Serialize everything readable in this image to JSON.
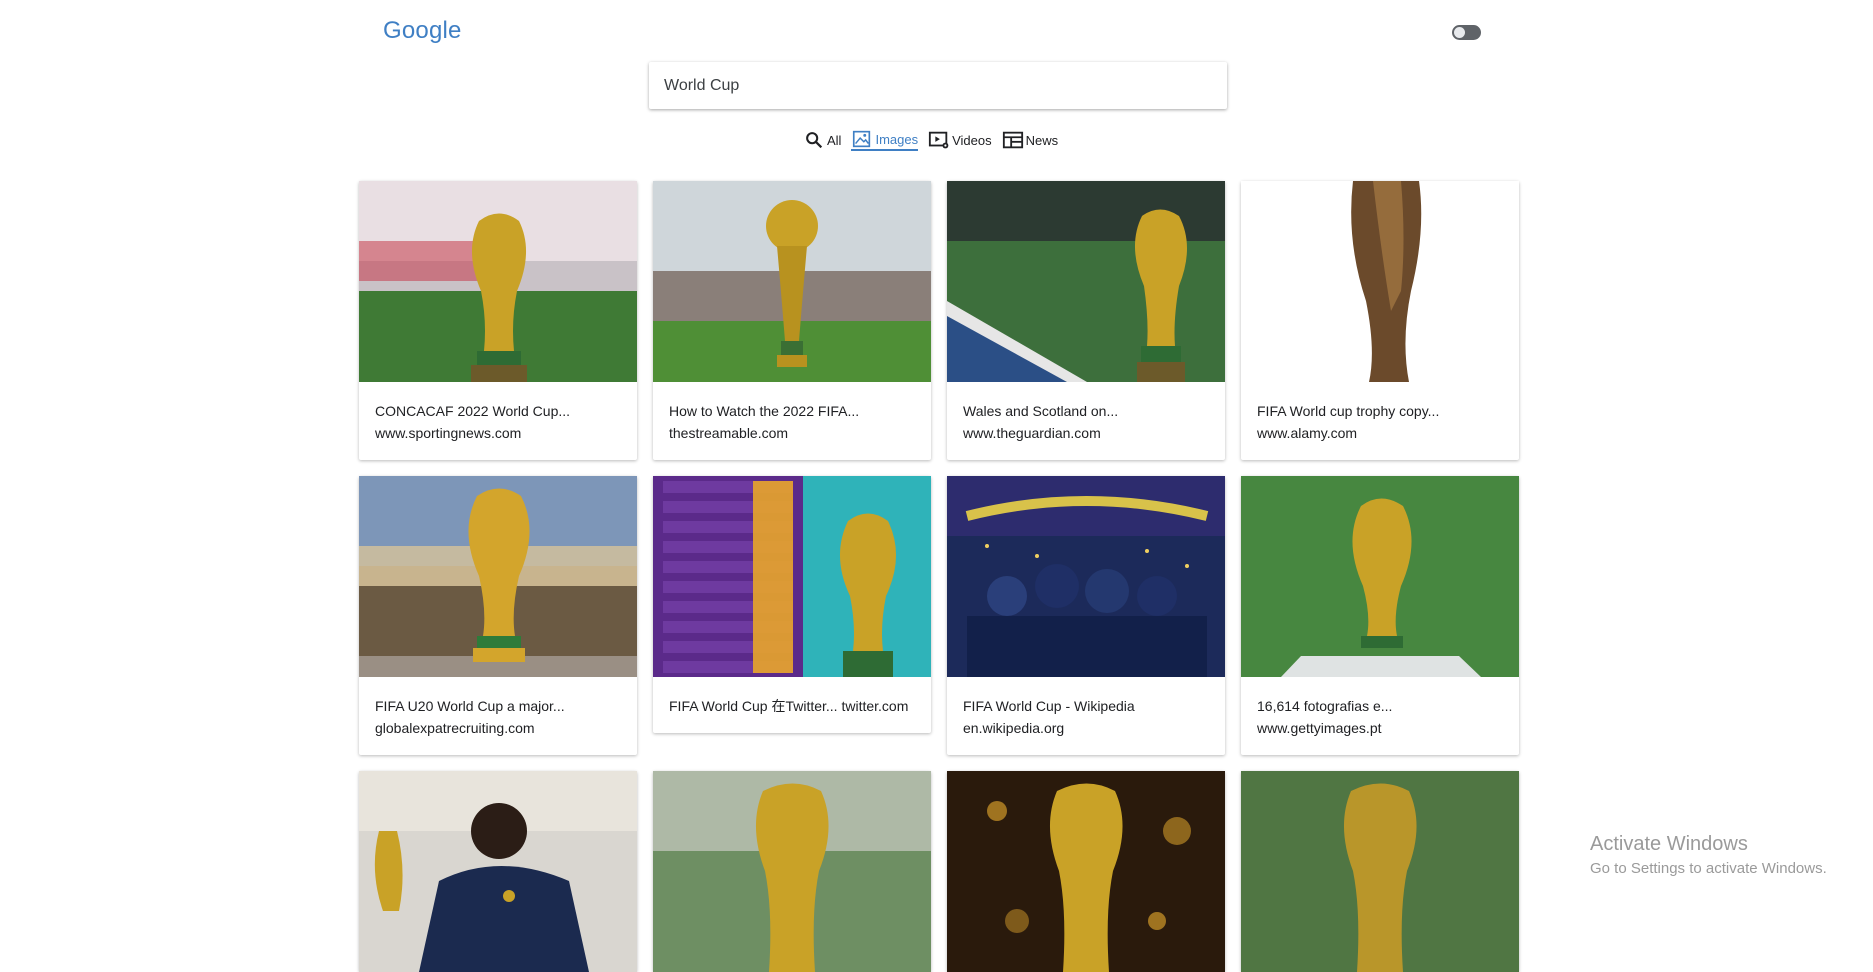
{
  "header": {
    "logo": "Google",
    "theme_toggle_icon": "toggle-switch-icon"
  },
  "search": {
    "value": "World Cup",
    "placeholder": ""
  },
  "tabs": [
    {
      "label": "All",
      "icon": "search-icon",
      "active": false
    },
    {
      "label": "Images",
      "icon": "image-icon",
      "active": true
    },
    {
      "label": "Videos",
      "icon": "video-settings-icon",
      "active": false
    },
    {
      "label": "News",
      "icon": "news-icon",
      "active": false
    }
  ],
  "results": [
    {
      "title": "CONCACAF 2022 World Cup...",
      "source": "www.sportingnews.com"
    },
    {
      "title": "How to Watch the 2022 FIFA...",
      "source": "thestreamable.com"
    },
    {
      "title": "Wales and Scotland on...",
      "source": "www.theguardian.com"
    },
    {
      "title": "FIFA World cup trophy copy...",
      "source": "www.alamy.com"
    },
    {
      "title": "FIFA U20 World Cup a major...",
      "source": "globalexpatrecruiting.com"
    },
    {
      "title": "FIFA World Cup 在Twitter... twitter.com",
      "source": ""
    },
    {
      "title": "FIFA World Cup - Wikipedia",
      "source": "en.wikipedia.org"
    },
    {
      "title": "16,614 fotografias e...",
      "source": "www.gettyimages.pt"
    },
    {
      "title": "",
      "source": ""
    },
    {
      "title": "",
      "source": ""
    },
    {
      "title": "",
      "source": ""
    },
    {
      "title": "",
      "source": ""
    }
  ],
  "watermark": {
    "title": "Activate Windows",
    "subtitle": "Go to Settings to activate Windows."
  },
  "colors": {
    "accent": "#3f7fc4",
    "trophy_gold": "#c9a227"
  }
}
